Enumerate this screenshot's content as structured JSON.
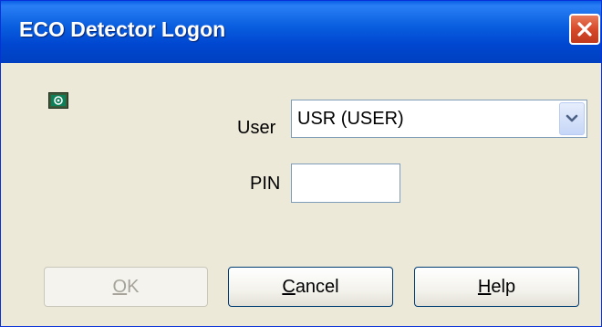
{
  "window": {
    "title": "ECO Detector Logon",
    "close_icon": "close-icon"
  },
  "form": {
    "user_label": "User",
    "user_value": "USR (USER)",
    "pin_label": "PIN",
    "pin_value": ""
  },
  "buttons": {
    "ok": {
      "accel": "O",
      "rest": "K",
      "enabled": false
    },
    "cancel": {
      "accel": "C",
      "rest": "ancel"
    },
    "help": {
      "accel": "H",
      "rest": "elp"
    }
  },
  "colors": {
    "titlebar": "#0a5fe6",
    "close": "#d6492a",
    "client": "#ece9d8"
  }
}
